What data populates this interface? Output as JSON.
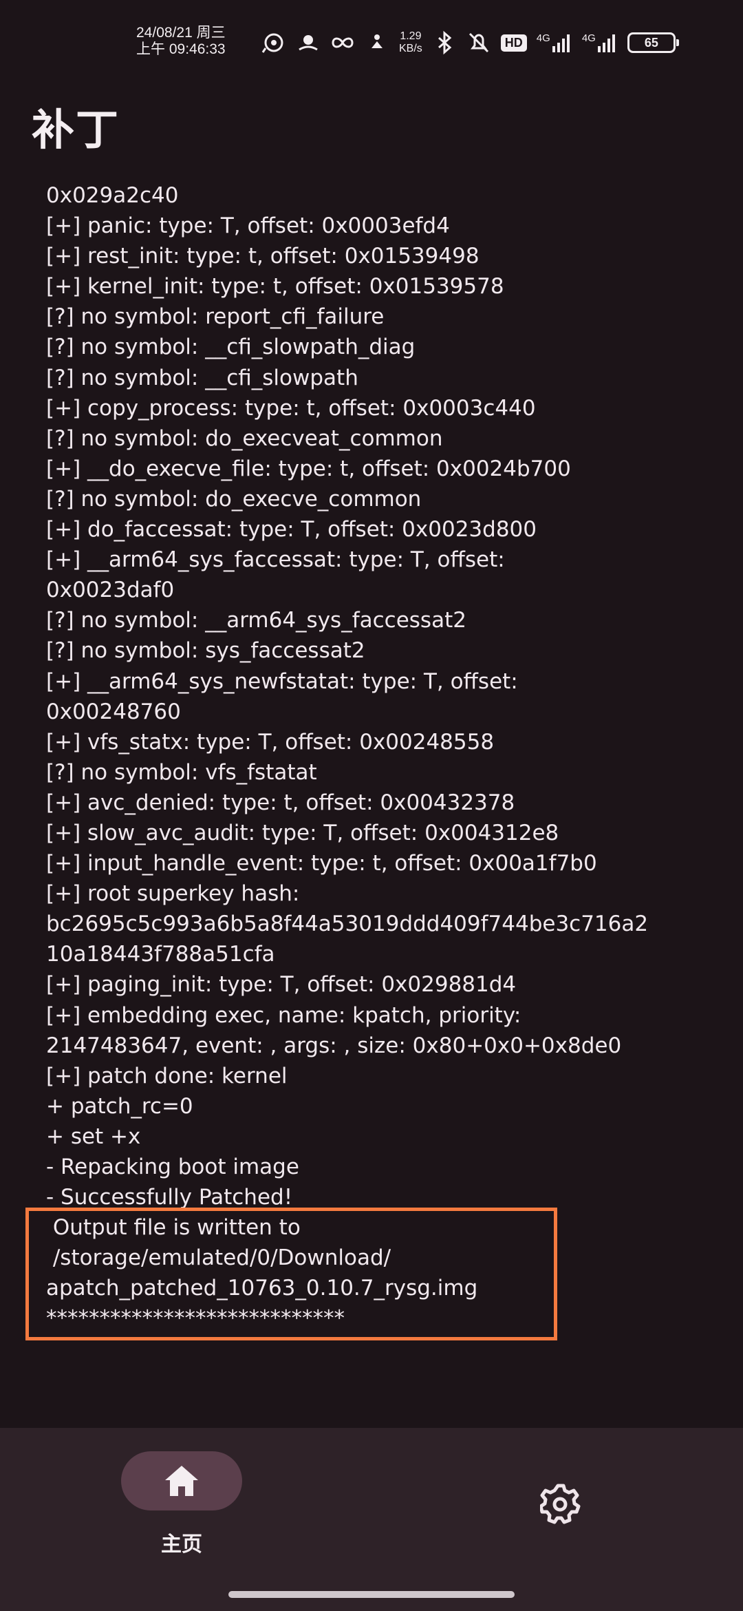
{
  "status_bar": {
    "date": "24/08/21 周三",
    "time": "上午 09:46:33",
    "net_speed_value": "1.29",
    "net_speed_unit": "KB/s",
    "hd_label": "HD",
    "sim1_label": "4G",
    "sim2_label": "4G",
    "battery": "65"
  },
  "app": {
    "title": "补丁"
  },
  "log_lines": [
    "0x029a2c40",
    "[+] panic: type: T, offset: 0x0003efd4",
    "[+] rest_init: type: t, offset: 0x01539498",
    "[+] kernel_init: type: t, offset: 0x01539578",
    "[?] no symbol: report_cfi_failure",
    "[?] no symbol: __cfi_slowpath_diag",
    "[?] no symbol: __cfi_slowpath",
    "[+] copy_process: type: t, offset: 0x0003c440",
    "[?] no symbol: do_execveat_common",
    "[+] __do_execve_file: type: t, offset: 0x0024b700",
    "[?] no symbol: do_execve_common",
    "[+] do_faccessat: type: T, offset: 0x0023d800",
    "[+] __arm64_sys_faccessat: type: T, offset:",
    "0x0023daf0",
    "[?] no symbol: __arm64_sys_faccessat2",
    "[?] no symbol: sys_faccessat2",
    "[+] __arm64_sys_newfstatat: type: T, offset:",
    "0x00248760",
    "[+] vfs_statx: type: T, offset: 0x00248558",
    "[?] no symbol: vfs_fstatat",
    "[+] avc_denied: type: t, offset: 0x00432378",
    "[+] slow_avc_audit: type: T, offset: 0x004312e8",
    "[+] input_handle_event: type: t, offset: 0x00a1f7b0",
    "[+] root superkey hash:",
    "bc2695c5c993a6b5a8f44a53019ddd409f744be3c716a2",
    "10a18443f788a51cfa",
    "[+] paging_init: type: T, offset: 0x029881d4",
    "[+] embedding exec, name: kpatch, priority:",
    "2147483647, event: , args: , size: 0x80+0x0+0x8de0",
    "[+] patch done: kernel",
    "+ patch_rc=0",
    "+ set +x",
    "- Repacking boot image",
    "- Successfully Patched!",
    " Output file is written to",
    " /storage/emulated/0/Download/",
    "apatch_patched_10763_0.10.7_rysg.img",
    "****************************"
  ],
  "bottom_nav": {
    "home_label": "主页",
    "home_icon": "home-icon",
    "settings_icon": "gear-icon"
  },
  "colors": {
    "background": "#1c1418",
    "nav_background": "#2e2228",
    "nav_pill": "#5b3f4c",
    "highlight": "#f47a3f",
    "text": "#f1e9ee"
  }
}
